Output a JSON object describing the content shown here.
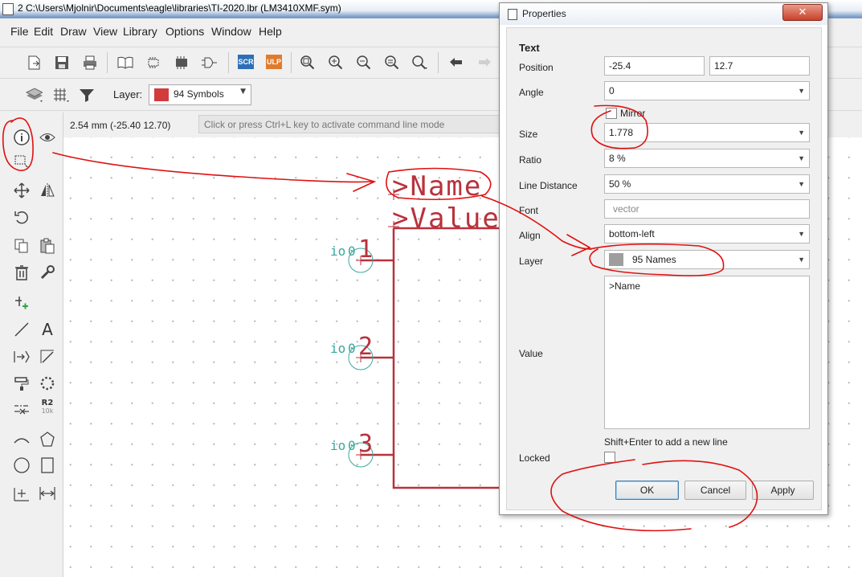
{
  "window": {
    "title": "2 C:\\Users\\Mjolnir\\Documents\\eagle\\libraries\\TI-2020.lbr (LM3410XMF.sym)"
  },
  "menu": [
    "File",
    "Edit",
    "Draw",
    "View",
    "Library",
    "Options",
    "Window",
    "Help"
  ],
  "toolbar": {
    "scr_label": "SCR",
    "ulp_label": "ULP"
  },
  "layer_bar": {
    "label": "Layer:",
    "selected": "94 Symbols",
    "swatch_color": "#d23c3c"
  },
  "status": {
    "coords": "2.54 mm (-25.40 12.70)",
    "cmd_placeholder": "Click or press Ctrl+L key to activate command line mode"
  },
  "schematic": {
    "name_text": ">Name",
    "value_text": ">Value",
    "pins": [
      {
        "io": "io",
        "dir": "0",
        "num": "1"
      },
      {
        "io": "io",
        "dir": "0",
        "num": "2"
      },
      {
        "io": "io",
        "dir": "0",
        "num": "3"
      }
    ],
    "tool_r2": "R2",
    "tool_10k": "10k",
    "tool_text": "A"
  },
  "dialog": {
    "title": "Properties",
    "close": "✕",
    "section": "Text",
    "position_label": "Position",
    "position_x": "-25.4",
    "position_y": "12.7",
    "angle_label": "Angle",
    "angle_value": "0",
    "mirror_label": "Mirror",
    "size_label": "Size",
    "size_value": "1.778",
    "ratio_label": "Ratio",
    "ratio_value": "8 %",
    "line_distance_label": "Line Distance",
    "line_distance_value": "50 %",
    "font_label": "Font",
    "font_value": "vector",
    "align_label": "Align",
    "align_value": "bottom-left",
    "layer_label": "Layer",
    "layer_value": "95 Names",
    "layer_swatch": "#9e9e9e",
    "value_label": "Value",
    "value_text": ">Name",
    "hint": "Shift+Enter to add a new line",
    "locked_label": "Locked",
    "ok": "OK",
    "cancel": "Cancel",
    "apply": "Apply"
  }
}
